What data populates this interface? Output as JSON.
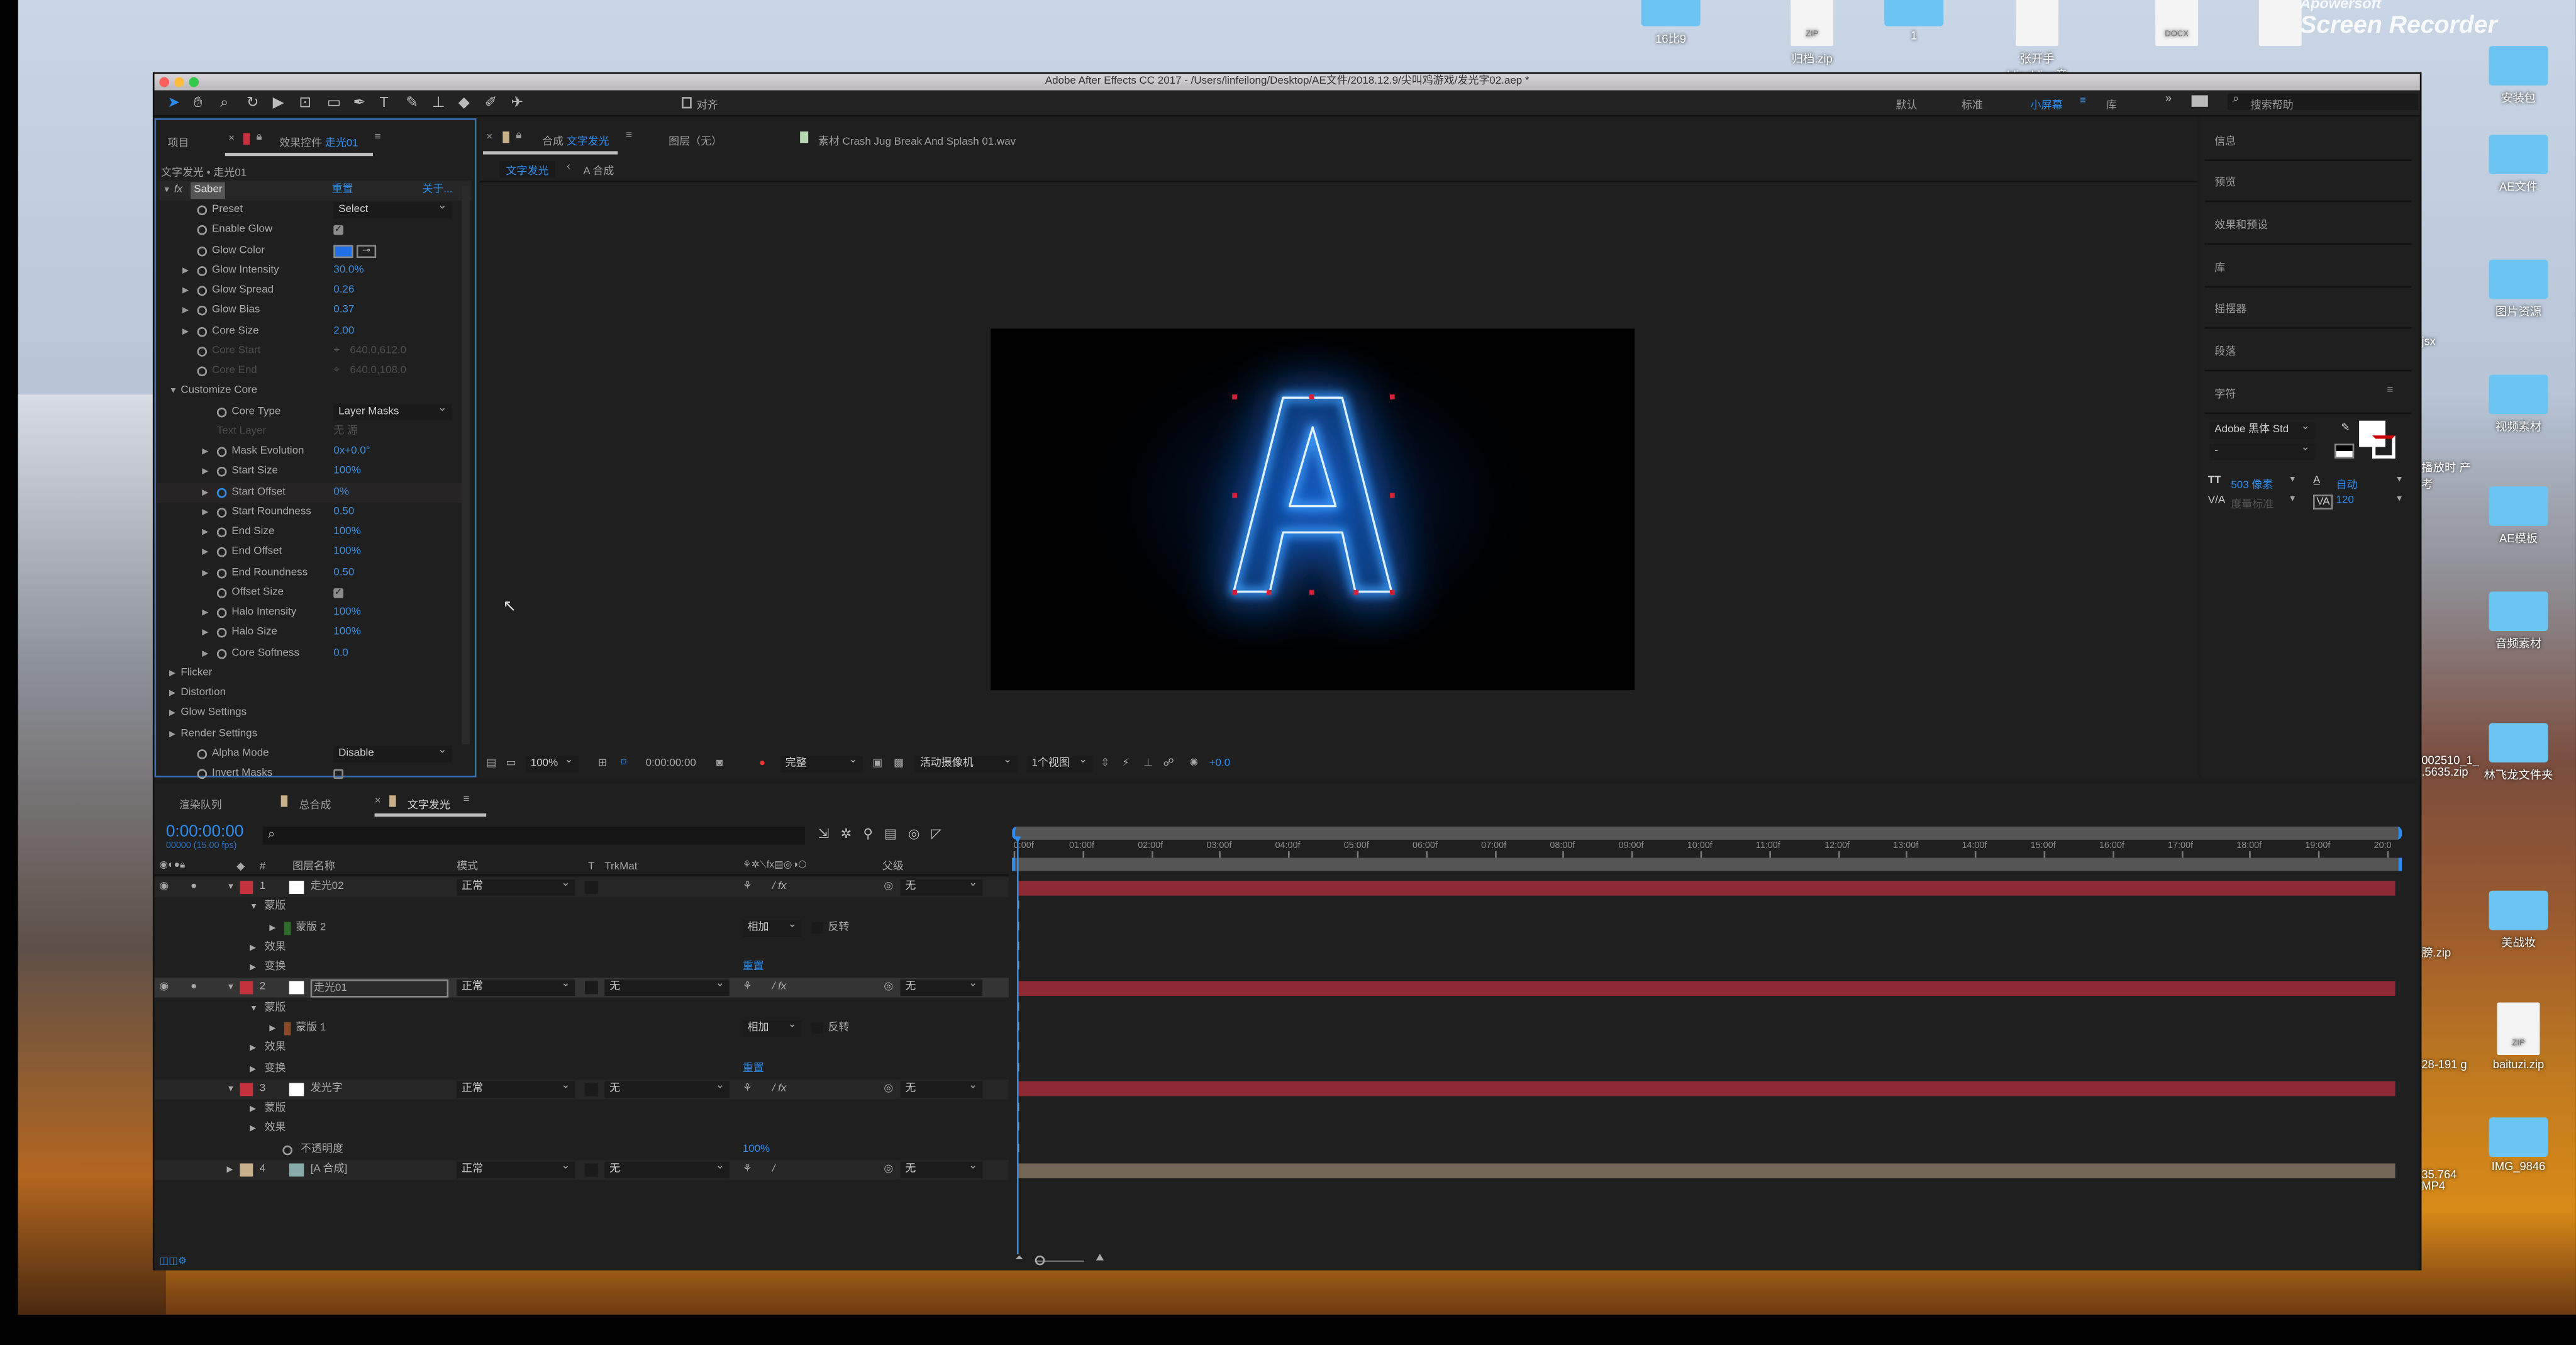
{
  "window": {
    "title": "Adobe After Effects CC 2017 - /Users/linfeilong/Desktop/AE文件/2018.12.9/尖叫鸡游戏/发光字02.aep *"
  },
  "toolbar": {
    "tools": [
      "selection-tool",
      "hand-tool",
      "zoom-tool",
      "rotate-tool",
      "camera-tool",
      "pan-behind-tool",
      "rectangle-tool",
      "pen-tool",
      "type-tool",
      "brush-tool",
      "clone-stamp-tool",
      "eraser-tool",
      "roto-brush-tool",
      "puppet-pin-tool"
    ],
    "snap_label": "对齐",
    "workspaces": [
      "默认",
      "标准",
      "小屏幕",
      "库"
    ],
    "active_workspace": "小屏幕",
    "search_placeholder": "搜索帮助"
  },
  "left_panel": {
    "tab_project": "项目",
    "tab_effects_prefix": "效果控件",
    "tab_effects_layer": "走光01",
    "breadcrumb": "文字发光 • 走光01",
    "effect_name": "Saber",
    "reset_label": "重置",
    "about_label": "关于...",
    "rows": [
      {
        "label": "Preset",
        "kind": "dropdown",
        "value": "Select",
        "lvl": 1,
        "twirl": false
      },
      {
        "label": "Enable Glow",
        "kind": "check",
        "value": "on",
        "lvl": 1,
        "twirl": false
      },
      {
        "label": "Glow Color",
        "kind": "color",
        "value": "#1f6fe6",
        "lvl": 1,
        "twirl": false
      },
      {
        "label": "Glow Intensity",
        "kind": "num",
        "value": "30.0%",
        "lvl": 1,
        "twirl": true
      },
      {
        "label": "Glow Spread",
        "kind": "num",
        "value": "0.26",
        "lvl": 1,
        "twirl": true
      },
      {
        "label": "Glow Bias",
        "kind": "num",
        "value": "0.37",
        "lvl": 1,
        "twirl": true
      },
      {
        "label": "Core Size",
        "kind": "num",
        "value": "2.00",
        "lvl": 1,
        "twirl": true
      },
      {
        "label": "Core Start",
        "kind": "point",
        "value": "640.0,612.0",
        "lvl": 1,
        "twirl": false,
        "disabled": true
      },
      {
        "label": "Core End",
        "kind": "point",
        "value": "640.0,108.0",
        "lvl": 1,
        "twirl": false,
        "disabled": true
      },
      {
        "label": "Customize Core",
        "kind": "group",
        "open": true,
        "lvl": 0
      },
      {
        "label": "Core Type",
        "kind": "dropdown",
        "value": "Layer Masks",
        "lvl": 2,
        "twirl": false
      },
      {
        "label": "Text Layer",
        "kind": "text",
        "value": "无    源",
        "lvl": 2,
        "disabled": true,
        "nosw": true
      },
      {
        "label": "Mask Evolution",
        "kind": "num",
        "value": "0x+0.0°",
        "lvl": 2,
        "twirl": true
      },
      {
        "label": "Start Size",
        "kind": "num",
        "value": "100%",
        "lvl": 2,
        "twirl": true
      },
      {
        "label": "Start Offset",
        "kind": "num",
        "value": "0%",
        "lvl": 2,
        "twirl": true,
        "highlight": true
      },
      {
        "label": "Start Roundness",
        "kind": "num",
        "value": "0.50",
        "lvl": 2,
        "twirl": true
      },
      {
        "label": "End Size",
        "kind": "num",
        "value": "100%",
        "lvl": 2,
        "twirl": true
      },
      {
        "label": "End Offset",
        "kind": "num",
        "value": "100%",
        "lvl": 2,
        "twirl": true
      },
      {
        "label": "End Roundness",
        "kind": "num",
        "value": "0.50",
        "lvl": 2,
        "twirl": true
      },
      {
        "label": "Offset Size",
        "kind": "check",
        "value": "on",
        "lvl": 2,
        "twirl": false
      },
      {
        "label": "Halo Intensity",
        "kind": "num",
        "value": "100%",
        "lvl": 2,
        "twirl": true
      },
      {
        "label": "Halo Size",
        "kind": "num",
        "value": "100%",
        "lvl": 2,
        "twirl": true
      },
      {
        "label": "Core Softness",
        "kind": "num",
        "value": "0.0",
        "lvl": 2,
        "twirl": true
      },
      {
        "label": "Flicker",
        "kind": "group",
        "open": false,
        "lvl": 0
      },
      {
        "label": "Distortion",
        "kind": "group",
        "open": false,
        "lvl": 0
      },
      {
        "label": "Glow Settings",
        "kind": "group",
        "open": false,
        "lvl": 0
      },
      {
        "label": "Render Settings",
        "kind": "group",
        "open": false,
        "lvl": 0
      },
      {
        "label": "Alpha Mode",
        "kind": "dropdown",
        "value": "Disable",
        "lvl": 1,
        "twirl": false
      },
      {
        "label": "Invert Masks",
        "kind": "check",
        "value": "off",
        "lvl": 1,
        "twirl": false
      }
    ]
  },
  "viewer": {
    "tab_comp_prefix": "合成",
    "tab_comp_name": "文字发光",
    "tab_layer": "图层（无）",
    "tab_footage": "素材 Crash Jug Break And Splash 01.wav",
    "crumb_active": "文字发光",
    "crumb_next": "A 合成",
    "letter": "A",
    "glow_color": "#1e7bff",
    "bottom": {
      "zoom": "100%",
      "timecode": "0:00:00:00",
      "resolution": "完整",
      "camera": "活动摄像机",
      "views": "1个视图",
      "exposure": "+0.0"
    }
  },
  "right_panel": {
    "items": [
      "信息",
      "预览",
      "效果和预设",
      "库",
      "摇摆器",
      "段落",
      "字符"
    ],
    "font_family": "Adobe 黑体 Std",
    "font_style": "-",
    "font_size": "503 像素",
    "leading": "自动",
    "kerning": "度量标准",
    "tracking": "120"
  },
  "timeline": {
    "tabs": [
      "渲染队列",
      "总合成",
      "文字发光"
    ],
    "active_tab": "文字发光",
    "timecode": "0:00:00:00",
    "frame_info": "00000 (15.00 fps)",
    "headers": {
      "name": "图层名称",
      "mode": "模式",
      "t": "T",
      "trkmat": "TrkMat",
      "parent": "父级"
    },
    "ruler": [
      "0:00f",
      "01:00f",
      "02:00f",
      "03:00f",
      "04:00f",
      "05:00f",
      "06:00f",
      "07:00f",
      "08:00f",
      "09:00f",
      "10:00f",
      "11:00f",
      "12:00f",
      "13:00f",
      "14:00f",
      "15:00f",
      "16:00f",
      "17:00f",
      "18:00f",
      "19:00f",
      "20:0"
    ],
    "rows": [
      {
        "type": "layer",
        "num": "1",
        "name": "走光02",
        "color": "#c4323e",
        "mode": "正常",
        "trkmat": "",
        "parent": "无",
        "fx": true,
        "bar": "#8e2a36",
        "eye": true
      },
      {
        "type": "prop",
        "lvl": 1,
        "open": true,
        "label": "蒙版"
      },
      {
        "type": "mask",
        "lvl": 2,
        "label": "蒙版 2",
        "color": "#2f6b2a",
        "blend": "相加",
        "invert": "反转"
      },
      {
        "type": "prop",
        "lvl": 1,
        "open": false,
        "label": "效果"
      },
      {
        "type": "prop",
        "lvl": 1,
        "open": false,
        "label": "变换",
        "value": "重置"
      },
      {
        "type": "layer",
        "num": "2",
        "name": "走光01",
        "color": "#c4323e",
        "mode": "正常",
        "trkmat": "无",
        "parent": "无",
        "fx": true,
        "bar": "#8e2a36",
        "eye": true,
        "selected": true
      },
      {
        "type": "prop",
        "lvl": 1,
        "open": true,
        "label": "蒙版"
      },
      {
        "type": "mask",
        "lvl": 2,
        "label": "蒙版 1",
        "color": "#8a4a2a",
        "blend": "相加",
        "invert": "反转"
      },
      {
        "type": "prop",
        "lvl": 1,
        "open": false,
        "label": "效果"
      },
      {
        "type": "prop",
        "lvl": 1,
        "open": false,
        "label": "变换",
        "value": "重置"
      },
      {
        "type": "layer",
        "num": "3",
        "name": "发光字",
        "color": "#c4323e",
        "mode": "正常",
        "trkmat": "无",
        "parent": "无",
        "fx": true,
        "bar": "#8e2a36",
        "eye": false
      },
      {
        "type": "prop",
        "lvl": 1,
        "open": false,
        "label": "蒙版"
      },
      {
        "type": "prop",
        "lvl": 1,
        "open": false,
        "label": "效果"
      },
      {
        "type": "prop",
        "lvl": 1,
        "stopwatch": true,
        "label": "不透明度",
        "value": "100%"
      },
      {
        "type": "layer",
        "num": "4",
        "name": "[A 合成]",
        "color": "#c7b08a",
        "mode": "正常",
        "trkmat": "无",
        "parent": "无",
        "fx": false,
        "bar": "#736659",
        "eye": false,
        "comp": true
      }
    ]
  },
  "desktop": {
    "top": [
      {
        "label": "16比9",
        "kind": "folder"
      },
      {
        "label": "归档.zip",
        "kind": "zip"
      },
      {
        "label": "1",
        "kind": "folder"
      },
      {
        "label": "张开手blingbling音",
        "kind": "audio"
      },
      {
        "label": "",
        "kind": "docx",
        "badge": "DOCX"
      },
      {
        "label": "",
        "kind": "image"
      }
    ],
    "right": [
      "安装包",
      "AE文件",
      "图片资源",
      "视频素材",
      "AE模板",
      "音频素材",
      "林飞龙文件夹",
      "美战妆",
      "baituzi.zip",
      "IMG_9846"
    ],
    "partial": [
      "jsx",
      "播放时 产考",
      "002510_1_ .5635.zip",
      "膀.zip",
      "28-191 g",
      "35.764 MP4"
    ],
    "watermark": {
      "brand": "Apowersoft",
      "product": "Screen Recorder"
    }
  }
}
